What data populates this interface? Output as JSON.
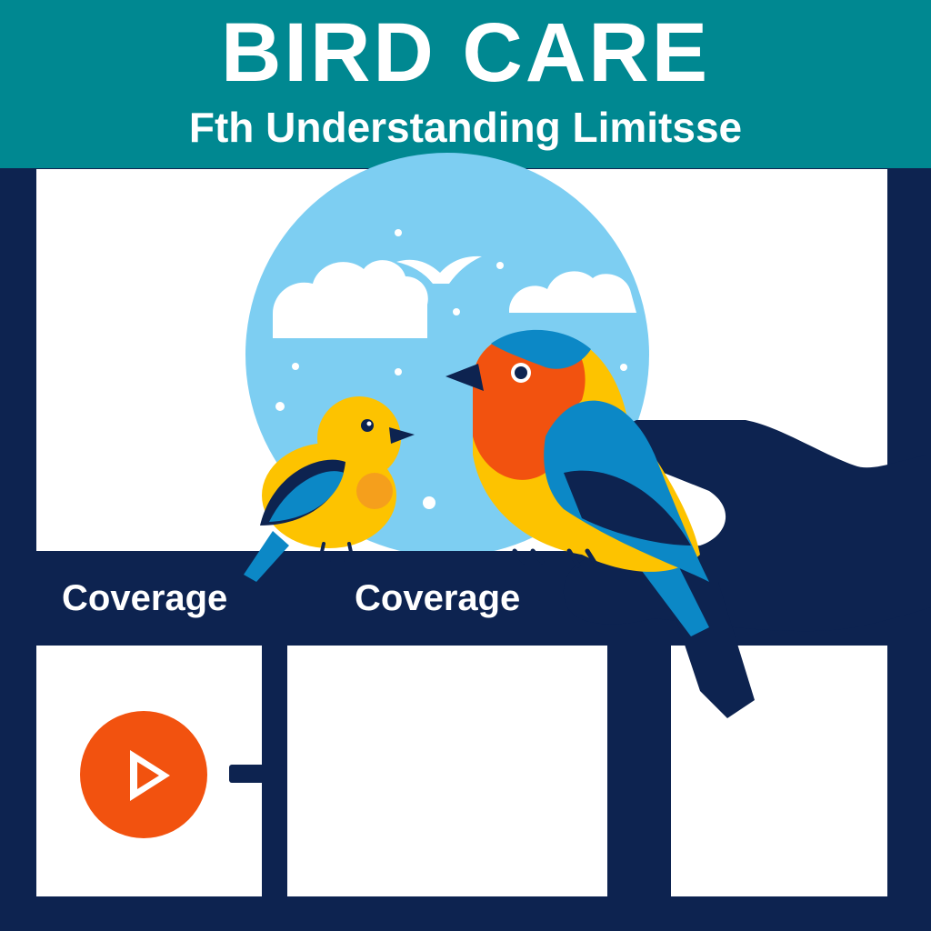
{
  "header": {
    "title": "BIRD CARE",
    "subtitle": "Fth Understanding Limitsse"
  },
  "labels": {
    "coverage_left": "Coverage",
    "coverage_right": "Coverage"
  },
  "colors": {
    "header_teal": "#008891",
    "navy": "#0d2350",
    "sky_blue": "#7dcef2",
    "yellow_bird": "#fdc300",
    "robin_orange": "#f2520f",
    "wing_blue": "#0c88c6",
    "play_orange": "#f2520f"
  },
  "icons": {
    "play_button": "play-icon"
  }
}
